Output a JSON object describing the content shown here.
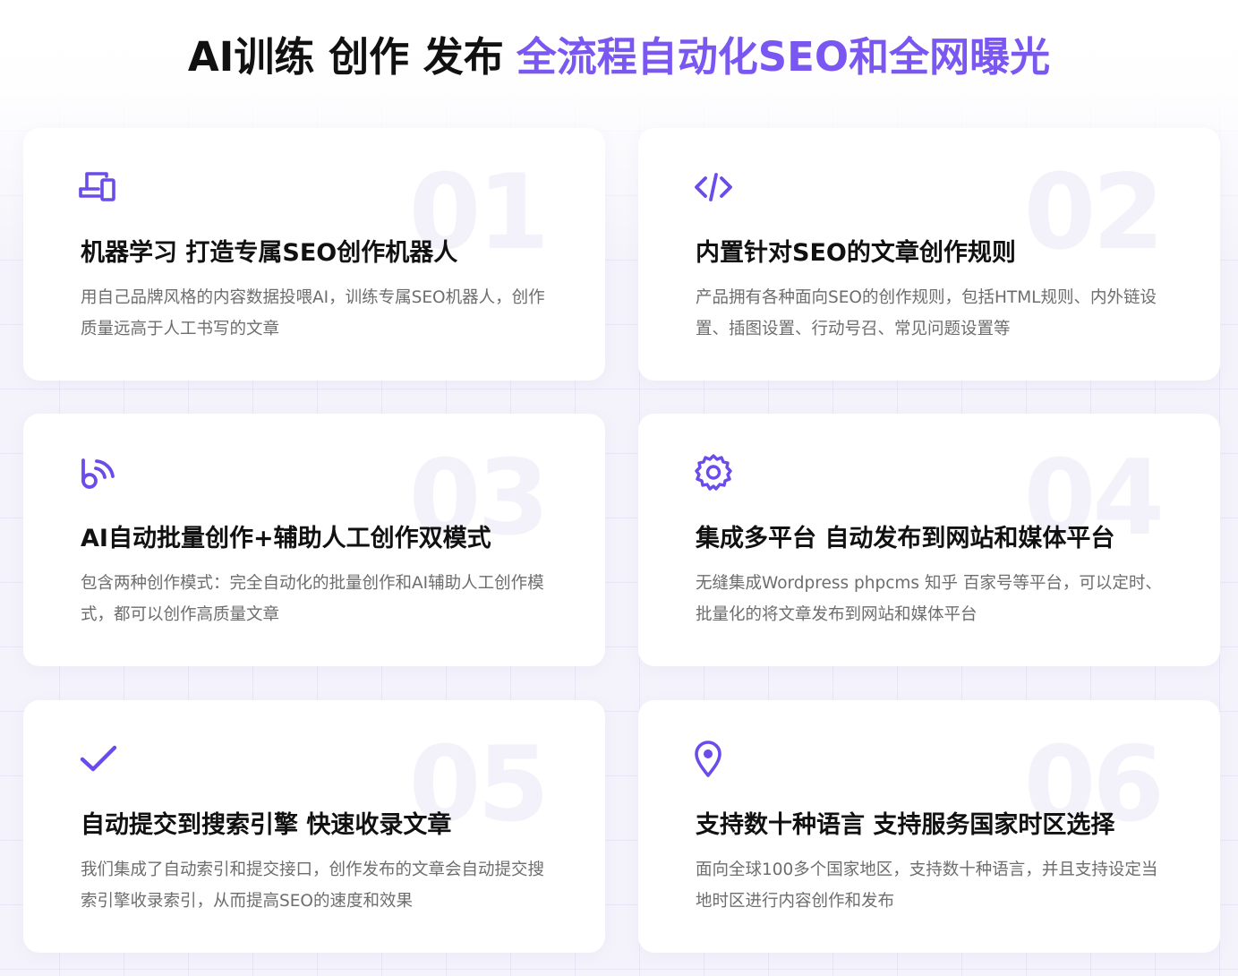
{
  "header": {
    "title_main": "AI训练 创作 发布",
    "title_accent": "全流程自动化SEO和全网曝光"
  },
  "accent_color": "#6b4bea",
  "cards": [
    {
      "number": "01",
      "icon": "devices-icon",
      "title": "机器学习 打造专属SEO创作机器人",
      "description": "用自己品牌风格的内容数据投喂AI，训练专属SEO机器人，创作质量远高于人工书写的文章"
    },
    {
      "number": "02",
      "icon": "code-icon",
      "title": "内置针对SEO的文章创作规则",
      "description": "产品拥有各种面向SEO的创作规则，包括HTML规则、内外链设置、插图设置、行动号召、常见问题设置等"
    },
    {
      "number": "03",
      "icon": "broadcast-icon",
      "title": "AI自动批量创作+辅助人工创作双模式",
      "description": "包含两种创作模式：完全自动化的批量创作和AI辅助人工创作模式，都可以创作高质量文章"
    },
    {
      "number": "04",
      "icon": "gear-icon",
      "title": "集成多平台 自动发布到网站和媒体平台",
      "description": "无缝集成Wordpress phpcms 知乎 百家号等平台，可以定时、批量化的将文章发布到网站和媒体平台"
    },
    {
      "number": "05",
      "icon": "checkmark-icon",
      "title": "自动提交到搜索引擎 快速收录文章",
      "description": "我们集成了自动索引和提交接口，创作发布的文章会自动提交搜索引擎收录索引，从而提高SEO的速度和效果"
    },
    {
      "number": "06",
      "icon": "location-pin-icon",
      "title": "支持数十种语言 支持服务国家时区选择",
      "description": "面向全球100多个国家地区，支持数十种语言，并且支持设定当地时区进行内容创作和发布"
    }
  ]
}
